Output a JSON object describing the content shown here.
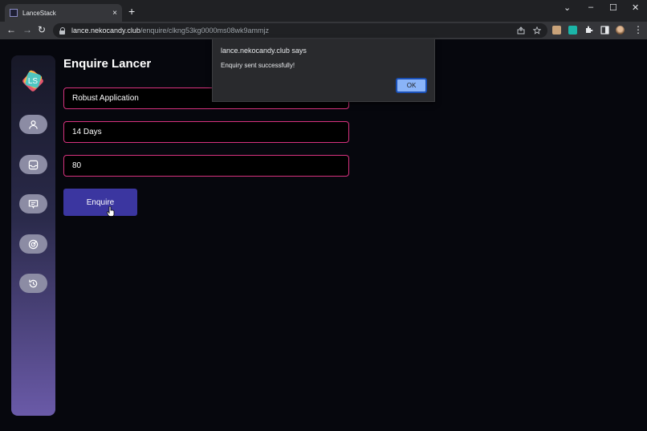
{
  "browser": {
    "tab_title": "LanceStack",
    "tab_close": "×",
    "new_tab": "+",
    "url_host": "lance.nekocandy.club",
    "url_path": "/enquire/clkng53kg0000ms08wk9ammjz",
    "window_controls": {
      "chevron": "⌄",
      "minimize": "–",
      "maximize": "☐",
      "close": "✕"
    },
    "nav": {
      "back": "←",
      "forward": "→",
      "reload": "↻"
    },
    "menu": "⋮"
  },
  "sidebar": {
    "logo_letters": "LS",
    "items": [
      {
        "name": "profile",
        "icon": "user-icon"
      },
      {
        "name": "inbox",
        "icon": "inbox-icon"
      },
      {
        "name": "messages",
        "icon": "chat-icon"
      },
      {
        "name": "tracking",
        "icon": "target-icon"
      },
      {
        "name": "history",
        "icon": "history-icon"
      }
    ],
    "gradient": [
      "#171827",
      "#6a5aa8"
    ]
  },
  "page": {
    "title": "Enquire Lancer",
    "fields": {
      "project": "Robust Application",
      "duration": "14 Days",
      "budget": "80"
    },
    "submit_label": "Enquire"
  },
  "dialog": {
    "title": "lance.nekocandy.club says",
    "message": "Enquiry sent successfully!",
    "ok_label": "OK"
  },
  "colors": {
    "background": "#06070d",
    "field_border": "#d7327e",
    "button": "#3b36a0",
    "dialog_ok": "#8ab4f8"
  }
}
